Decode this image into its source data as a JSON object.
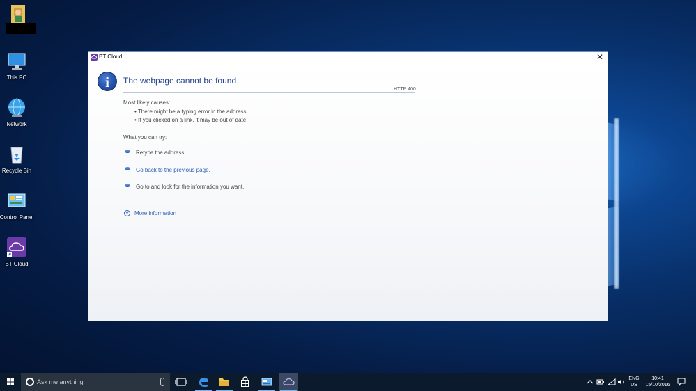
{
  "desktop": {
    "icons": [
      {
        "label": "",
        "icon": "user-folder-icon"
      },
      {
        "label": "This PC",
        "icon": "computer-icon"
      },
      {
        "label": "Network",
        "icon": "network-globe-icon"
      },
      {
        "label": "Recycle Bin",
        "icon": "recycle-bin-icon"
      },
      {
        "label": "Control Panel",
        "icon": "control-panel-icon"
      },
      {
        "label": "BT Cloud",
        "icon": "bt-cloud-shortcut-icon"
      }
    ]
  },
  "window": {
    "title": "BT Cloud",
    "close_glyph": "✕",
    "heading": "The webpage cannot be found",
    "http_code": "HTTP 400",
    "causes_label": "Most likely causes:",
    "causes": [
      "There might be a typing error in the address.",
      "If you clicked on a link, it may be out of date."
    ],
    "try_label": "What you can try:",
    "actions": [
      {
        "text": "Retype the address.",
        "link": false
      },
      {
        "text": "Go back to the previous page.",
        "link": true
      },
      {
        "text": "Go to  and look for the information you want.",
        "link": false
      }
    ],
    "more_info": "More information"
  },
  "taskbar": {
    "search_placeholder": "Ask me anything",
    "lang_line1": "ENG",
    "lang_line2": "US",
    "time": "10:41",
    "date": "15/10/2016"
  },
  "colors": {
    "accent": "#2b5fb3",
    "heading": "#1f3f8f",
    "bt_purple": "#6a3aa8",
    "taskbar": "#0b1a2c"
  }
}
